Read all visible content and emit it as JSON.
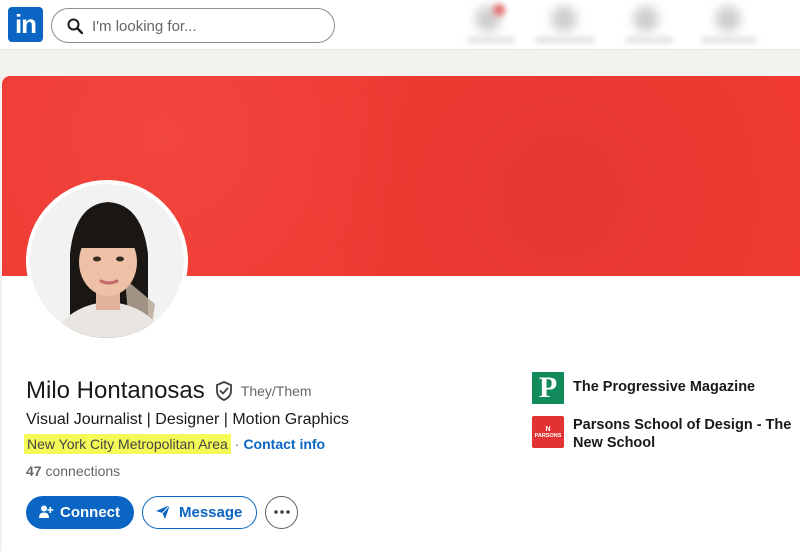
{
  "nav": {
    "logo_text": "in",
    "search_placeholder": "I'm looking for..."
  },
  "profile": {
    "name": "Milo Hontanosas",
    "pronouns": "They/Them",
    "headline": "Visual Journalist | Designer | Motion Graphics",
    "location": "New York City Metropolitan Area",
    "separator": "·",
    "contact_info": "Contact info",
    "connections_count": "47",
    "connections_label": "connections",
    "banner_color": "#f03a33"
  },
  "actions": {
    "connect": "Connect",
    "message": "Message"
  },
  "orgs": [
    {
      "name": "The Progressive Magazine",
      "logo_letter": "P",
      "logo_color": "#128a5c"
    },
    {
      "name": "Parsons School of Design - The New School",
      "logo_text": "PARSONS",
      "logo_color": "#e23333"
    }
  ],
  "colors": {
    "accent": "#0a66c2",
    "highlight": "#f4fb57"
  }
}
